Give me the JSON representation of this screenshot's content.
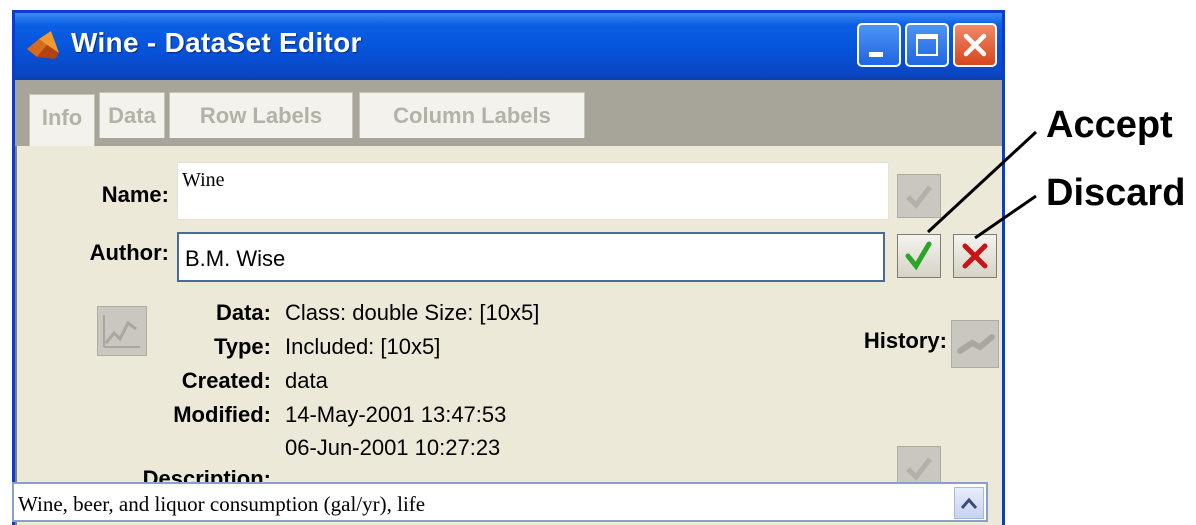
{
  "window": {
    "title": "Wine - DataSet Editor"
  },
  "titlebar_buttons": [
    "minimize-button",
    "maximize-button",
    "close-button"
  ],
  "tabs": [
    {
      "label": "Info",
      "active": true
    },
    {
      "label": "Data",
      "active": false
    },
    {
      "label": "Row Labels",
      "active": false
    },
    {
      "label": "Column Labels",
      "active": false
    }
  ],
  "info": {
    "name_label": "Name:",
    "name_value": "Wine",
    "author_label": "Author:",
    "author_value": "B.M. Wise",
    "data_label": "Data:",
    "data_value": "Class: double  Size: [10x5]",
    "type_label": "Type:",
    "type_value": "Included: [10x5]",
    "created_label": "Created:",
    "created_value": "data",
    "modified_label": "Modified:",
    "modified_value_1": "14-May-2001 13:47:53",
    "modified_value_2": "06-Jun-2001 10:27:23",
    "description_label": "Description:",
    "description_value": "Wine, beer, and liquor consumption (gal/yr), life",
    "history_label": "History:"
  },
  "annotations": {
    "accept": "Accept",
    "discard": "Discard"
  },
  "colors": {
    "accept_check": "#2aa52a",
    "discard_x": "#c81414",
    "titlebar": "#0653db"
  }
}
